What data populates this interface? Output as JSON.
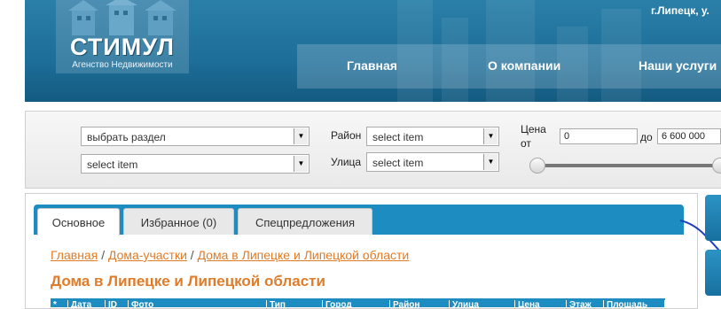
{
  "header": {
    "logo_name": "СТИМУЛ",
    "logo_subtitle": "Агенство Недвижимости",
    "address": "г.Липецк, у.",
    "menu": [
      "Главная",
      "О компании",
      "Наши услуги"
    ]
  },
  "filter": {
    "section_select": "выбрать раздел",
    "second_select": "select item",
    "district_label": "Район",
    "district_select": "select item",
    "street_label": "Улица",
    "street_select": "select item",
    "price_label": "Цена",
    "from_label": "от",
    "price_from": "0",
    "to_label": "до",
    "price_to": "6 600 000"
  },
  "tabs": [
    "Основное",
    "Избранное (0)",
    "Спецпредложения"
  ],
  "breadcrumb": {
    "items": [
      "Главная",
      "Дома-участки",
      "Дома в Липецке и Липецкой области"
    ],
    "separator": "/"
  },
  "page_title": "Дома в Липецке и Липецкой области",
  "table_headers": [
    "*",
    "Дата",
    "ID",
    "Фото",
    "Тип",
    "Город",
    "Район",
    "Улица",
    "Цена",
    "Этаж",
    "Площадь"
  ],
  "colors": {
    "header_blue": "#1d6e99",
    "tab_blue": "#1d8cc0",
    "accent_orange": "#e07b27"
  }
}
